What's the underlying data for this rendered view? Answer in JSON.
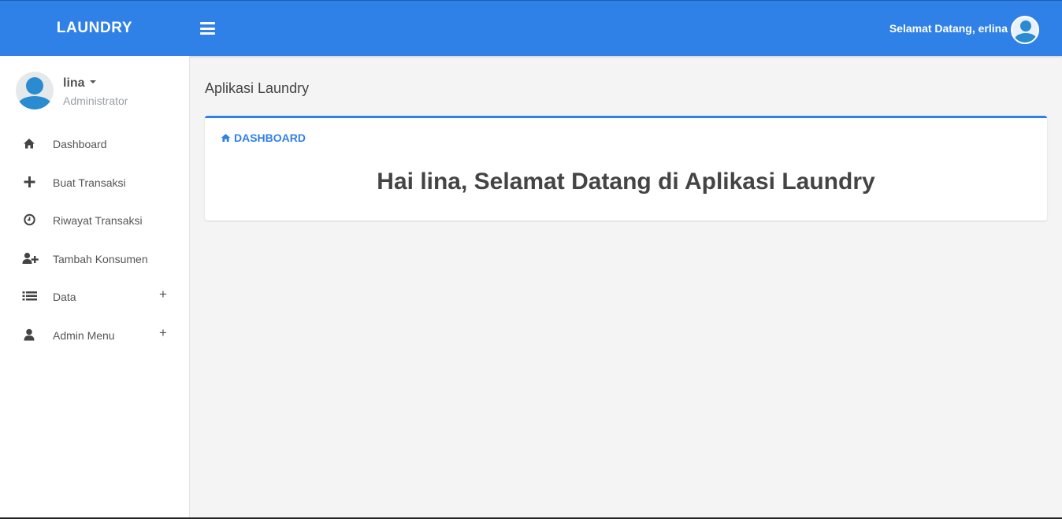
{
  "app": {
    "brand": "LAUNDRY",
    "welcome": "Selamat Datang, erlina"
  },
  "sidebar": {
    "user_name": "lina",
    "user_role": "Administrator",
    "items": [
      {
        "label": "Dashboard",
        "icon": "home-icon"
      },
      {
        "label": "Buat Transaksi",
        "icon": "plus-icon"
      },
      {
        "label": "Riwayat Transaksi",
        "icon": "clock-icon"
      },
      {
        "label": "Tambah Konsumen",
        "icon": "user-plus-icon"
      },
      {
        "label": "Data",
        "icon": "list-icon",
        "expand": "+"
      },
      {
        "label": "Admin Menu",
        "icon": "user-icon",
        "expand": "+"
      }
    ]
  },
  "main": {
    "page_title": "Aplikasi Laundry",
    "card_header": "DASHBOARD",
    "greeting": "Hai lina, Selamat Datang di Aplikasi Laundry"
  },
  "colors": {
    "primary": "#2f80e7",
    "text": "#555555",
    "background": "#f4f4f4"
  }
}
